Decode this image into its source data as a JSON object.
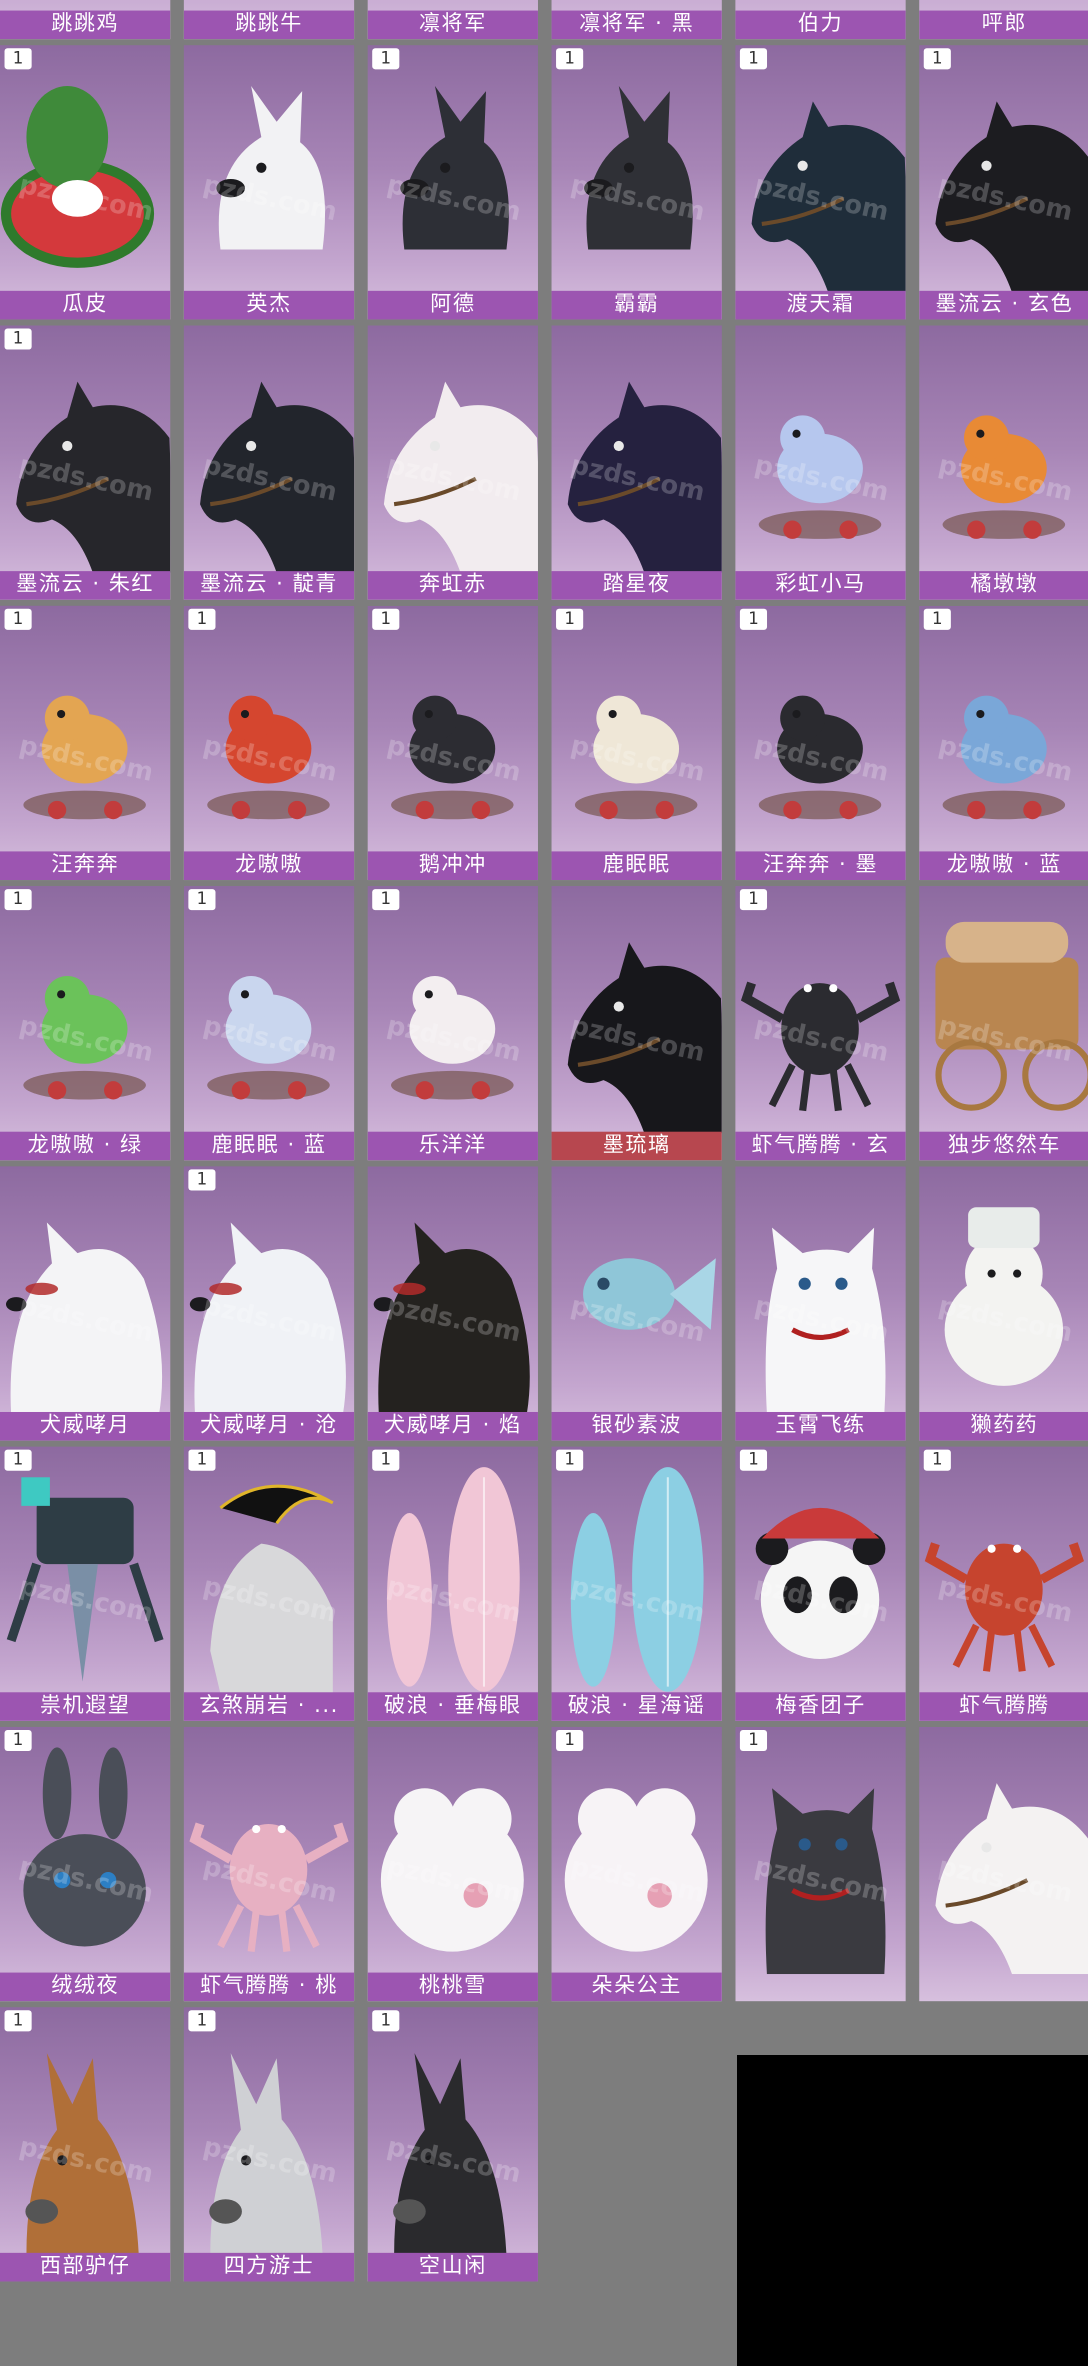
{
  "watermark": "pzds.com",
  "items": [
    {
      "name": "跳跳鸡",
      "badge": "",
      "color": "#e9c84a",
      "shape": "bird"
    },
    {
      "name": "跳跳牛",
      "badge": "",
      "color": "#e8e8ea",
      "shape": "blob"
    },
    {
      "name": "凛将军",
      "badge": "",
      "color": "#d9c9a8",
      "shape": "blob"
    },
    {
      "name": "凛将军 · 黑",
      "badge": "",
      "color": "#2a2a30",
      "shape": "blob"
    },
    {
      "name": "伯力",
      "badge": "",
      "color": "#c9c9cf",
      "shape": "blob"
    },
    {
      "name": "呯郎",
      "badge": "",
      "color": "#efe9ea",
      "shape": "blob"
    },
    {
      "name": "瓜皮",
      "badge": "1",
      "color": "#3f8a3a",
      "shape": "melon"
    },
    {
      "name": "英杰",
      "badge": "",
      "color": "#f2f2f4",
      "shape": "dog"
    },
    {
      "name": "阿德",
      "badge": "1",
      "color": "#2d2f36",
      "shape": "dog"
    },
    {
      "name": "霸霸",
      "badge": "1",
      "color": "#2f3036",
      "shape": "dog"
    },
    {
      "name": "渡天霜",
      "badge": "1",
      "color": "#1f2d3a",
      "shape": "horse"
    },
    {
      "name": "墨流云 · 玄色",
      "badge": "1",
      "color": "#1c1c20",
      "shape": "horse"
    },
    {
      "name": "墨流云 · 朱红",
      "badge": "1",
      "color": "#26262b",
      "shape": "horse"
    },
    {
      "name": "墨流云 · 靛青",
      "badge": "",
      "color": "#22252c",
      "shape": "horse"
    },
    {
      "name": "奔虹赤",
      "badge": "",
      "color": "#f2ecef",
      "shape": "horse"
    },
    {
      "name": "踏星夜",
      "badge": "",
      "color": "#25213f",
      "shape": "horse"
    },
    {
      "name": "彩虹小马",
      "badge": "",
      "color": "#b6c7ee",
      "shape": "toy"
    },
    {
      "name": "橘墩墩",
      "badge": "",
      "color": "#e88a35",
      "shape": "toy"
    },
    {
      "name": "汪奔奔",
      "badge": "1",
      "color": "#e3a552",
      "shape": "toy"
    },
    {
      "name": "龙嗷嗷",
      "badge": "1",
      "color": "#d5462f",
      "shape": "toy"
    },
    {
      "name": "鹅冲冲",
      "badge": "1",
      "color": "#2c2c32",
      "shape": "toy"
    },
    {
      "name": "鹿眠眠",
      "badge": "1",
      "color": "#efe7d7",
      "shape": "toy"
    },
    {
      "name": "汪奔奔 · 墨",
      "badge": "1",
      "color": "#2a2a2f",
      "shape": "toy"
    },
    {
      "name": "龙嗷嗷 · 蓝",
      "badge": "1",
      "color": "#7aa7d8",
      "shape": "toy"
    },
    {
      "name": "龙嗷嗷 · 绿",
      "badge": "1",
      "color": "#6bc25a",
      "shape": "toy"
    },
    {
      "name": "鹿眠眠 · 蓝",
      "badge": "1",
      "color": "#c9d6ee",
      "shape": "toy"
    },
    {
      "name": "乐洋洋",
      "badge": "1",
      "color": "#f3eef0",
      "shape": "toy"
    },
    {
      "name": "墨琉璃",
      "badge": "",
      "color": "#17171b",
      "shape": "horse",
      "label_style": "red"
    },
    {
      "name": "虾气腾腾 · 玄",
      "badge": "1",
      "color": "#2b2b30",
      "shape": "crab"
    },
    {
      "name": "独步悠然车",
      "badge": "",
      "color": "#b98650",
      "shape": "cart"
    },
    {
      "name": "犬威哮月",
      "badge": "",
      "color": "#f4f4f6",
      "shape": "wolf"
    },
    {
      "name": "犬威哮月 · 沧",
      "badge": "1",
      "color": "#f0f2f6",
      "shape": "wolf"
    },
    {
      "name": "犬威哮月 · 焰",
      "badge": "",
      "color": "#24221f",
      "shape": "wolf"
    },
    {
      "name": "银砂素波",
      "badge": "",
      "color": "#8fc6d8",
      "shape": "fish"
    },
    {
      "name": "玉霄飞练",
      "badge": "",
      "color": "#f6f6f8",
      "shape": "cat"
    },
    {
      "name": "獭药药",
      "badge": "",
      "color": "#f3f3f1",
      "shape": "bear"
    },
    {
      "name": "祟机遐望",
      "badge": "1",
      "color": "#2e3d45",
      "shape": "mech"
    },
    {
      "name": "玄煞崩岩 · ...",
      "badge": "1",
      "color": "#d8d8da",
      "shape": "ox"
    },
    {
      "name": "破浪 · 垂梅眼",
      "badge": "1",
      "color": "#f1c6d6",
      "shape": "board"
    },
    {
      "name": "破浪 · 星海谣",
      "badge": "1",
      "color": "#8ccfe3",
      "shape": "board"
    },
    {
      "name": "梅香团子",
      "badge": "1",
      "color": "#f5f5f5",
      "shape": "panda"
    },
    {
      "name": "虾气腾腾",
      "badge": "1",
      "color": "#c6442e",
      "shape": "crab"
    },
    {
      "name": "绒绒夜",
      "badge": "1",
      "color": "#4a4e58",
      "shape": "rabbit"
    },
    {
      "name": "虾气腾腾 · 桃",
      "badge": "",
      "color": "#e7b0c2",
      "shape": "crab"
    },
    {
      "name": "桃桃雪",
      "badge": "",
      "color": "#f6f4f6",
      "shape": "fluff"
    },
    {
      "name": "朵朵公主",
      "badge": "1",
      "color": "#f7f3f6",
      "shape": "fluff"
    },
    {
      "name": "",
      "badge": "1",
      "color": "#3a3a40",
      "shape": "cat"
    },
    {
      "name": "",
      "badge": "",
      "color": "#f4f2f2",
      "shape": "horse"
    },
    {
      "name": "西部驴仔",
      "badge": "1",
      "color": "#b06f38",
      "shape": "donkey"
    },
    {
      "name": "四方游士",
      "badge": "1",
      "color": "#cfd0d4",
      "shape": "donkey"
    },
    {
      "name": "空山闲",
      "badge": "1",
      "color": "#2a2a2d",
      "shape": "donkey"
    }
  ]
}
